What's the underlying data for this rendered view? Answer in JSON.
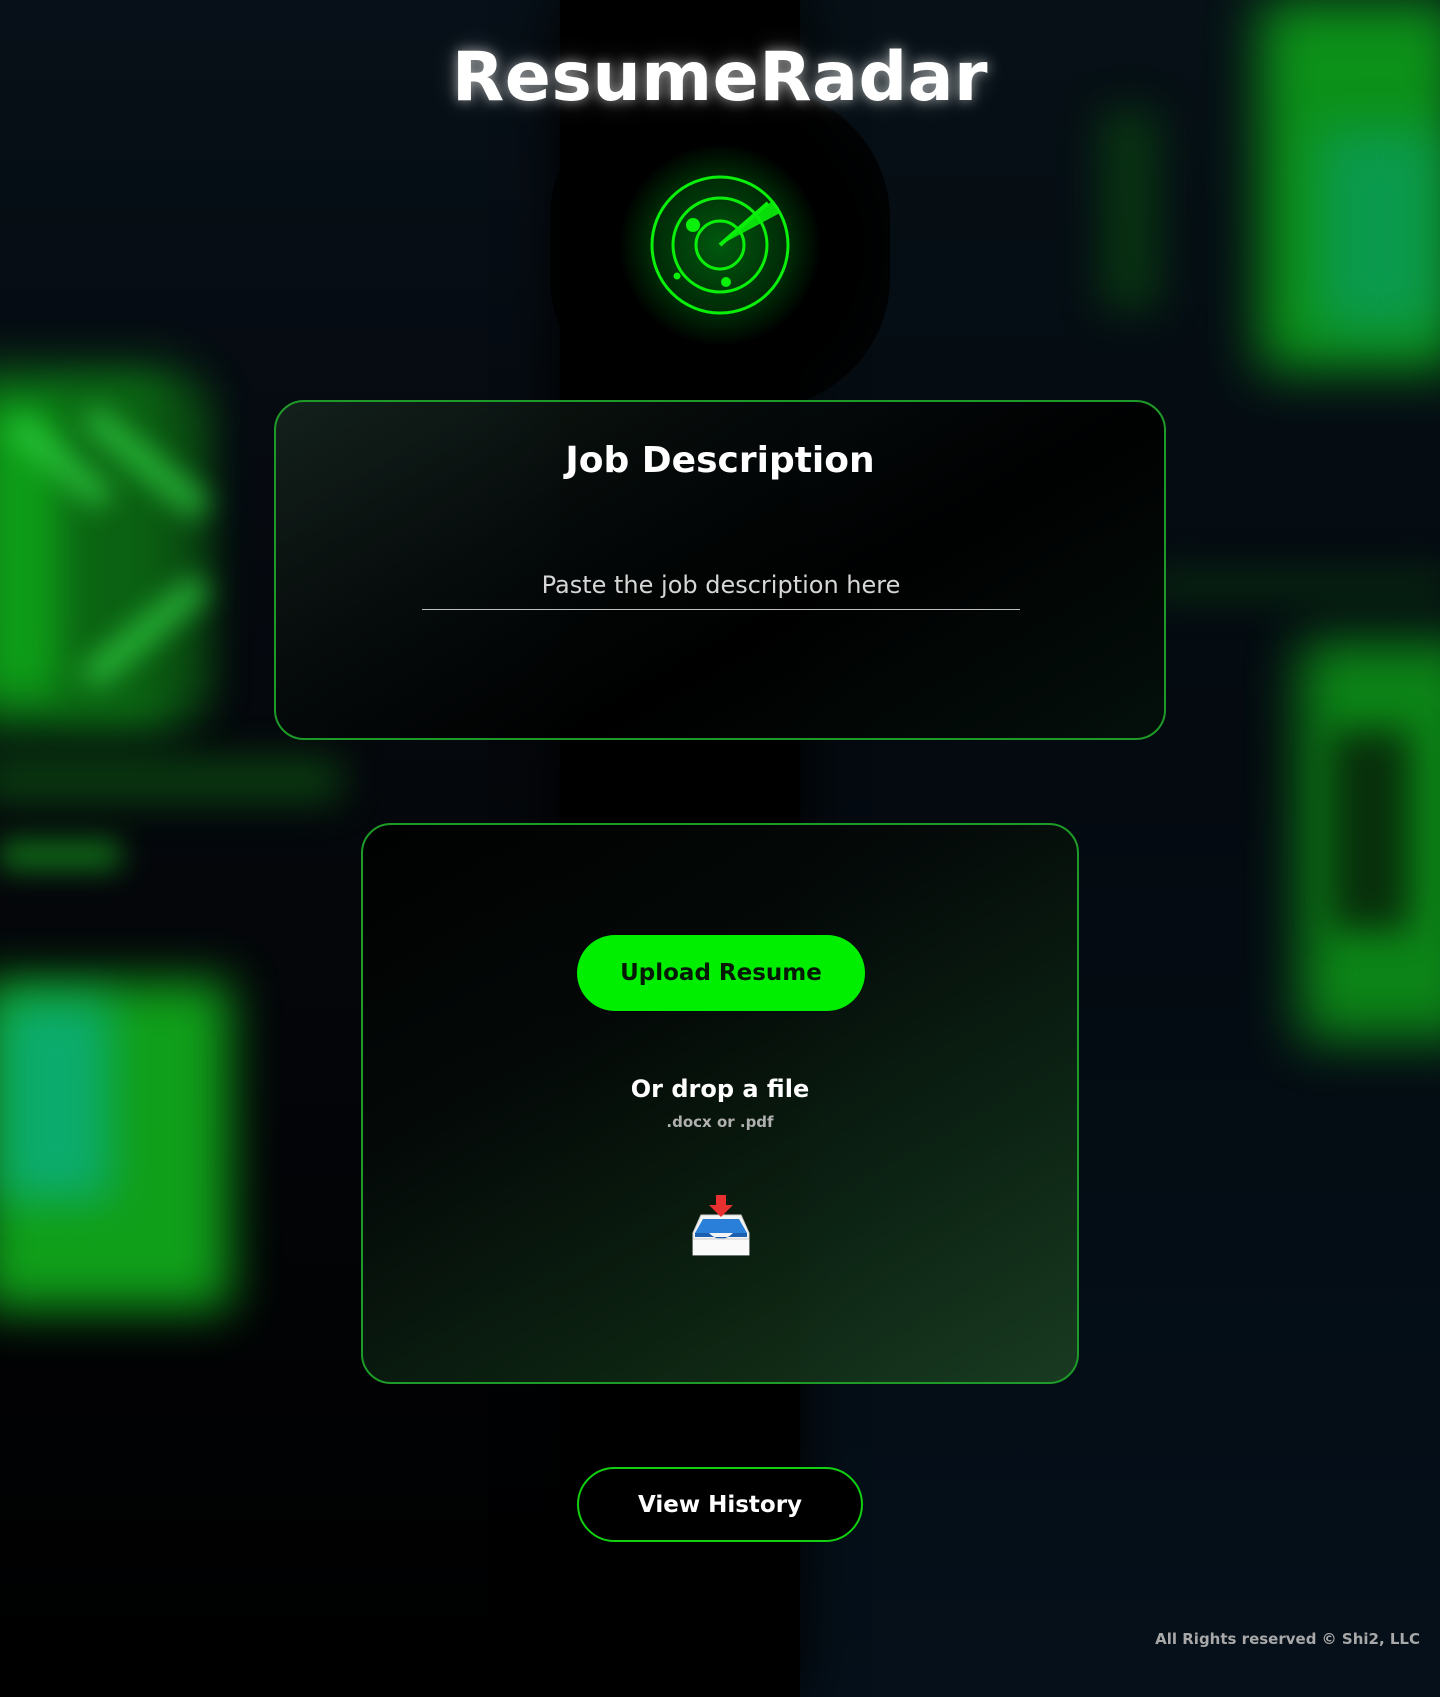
{
  "header": {
    "title": "ResumeRadar"
  },
  "job_description": {
    "heading": "Job Description",
    "placeholder": "Paste the job description here",
    "value": ""
  },
  "upload": {
    "button_label": "Upload Resume",
    "drop_title": "Or drop a file",
    "accepted_types": ".docx or .pdf",
    "drop_icon": "inbox-tray-icon"
  },
  "history": {
    "button_label": "View History"
  },
  "footer": {
    "text": "All Rights reserved © Shi2, LLC"
  },
  "colors": {
    "accent": "#00ee00",
    "border": "#1e9a28",
    "background": "#000000"
  }
}
